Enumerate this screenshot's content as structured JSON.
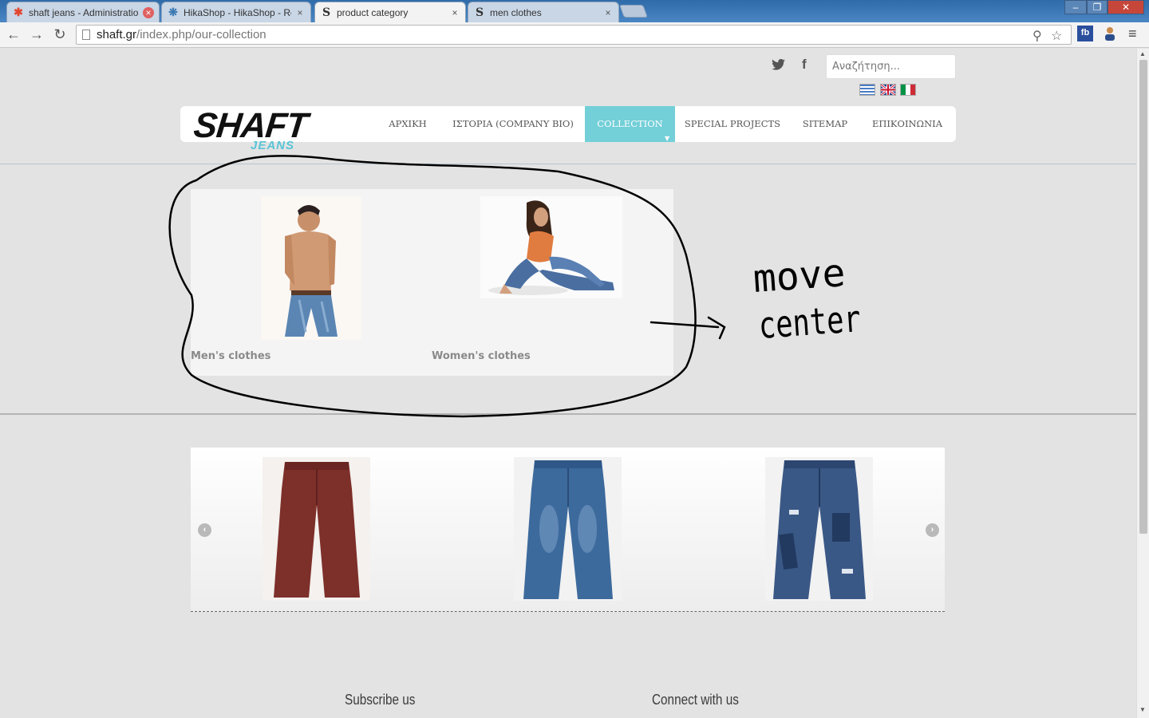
{
  "browser": {
    "tabs": [
      {
        "label": "shaft jeans - Administratio",
        "icon": "joomla-icon"
      },
      {
        "label": "HikaShop - HikaShop - Re",
        "icon": "hikashop-icon"
      },
      {
        "label": "product category",
        "icon": "shaft-s-icon"
      },
      {
        "label": "men clothes",
        "icon": "shaft-s-icon"
      }
    ],
    "url_host": "shaft.gr",
    "url_path": "/index.php/our-collection"
  },
  "header": {
    "search_placeholder": "Αναζήτηση...",
    "languages": [
      "Greek",
      "English",
      "Italian"
    ],
    "logo_main": "SHAFT",
    "logo_sub": "JEANS",
    "nav": [
      {
        "label": "ΑΡΧΙΚΗ"
      },
      {
        "label": "ΙΣΤΟΡΙΑ (COMPANY BIO)"
      },
      {
        "label": "COLLECTION"
      },
      {
        "label": "SPECIAL PROJECTS"
      },
      {
        "label": "SITEMAP"
      },
      {
        "label": "ΕΠΙΚΟΙΝΩΝΙΑ"
      }
    ]
  },
  "categories": [
    {
      "label": "Men's clothes"
    },
    {
      "label": "Women's clothes"
    }
  ],
  "carousel": {
    "products": [
      {
        "name": "red-chino-pants",
        "color": "#7d2f2a"
      },
      {
        "name": "blue-washed-jeans",
        "color": "#3d6a9c"
      },
      {
        "name": "patched-jeans",
        "color": "#3a5886"
      }
    ]
  },
  "footer": {
    "subscribe_title": "Subscribe us",
    "connect_title": "Connect with us"
  },
  "annotation": {
    "line1": "move",
    "line2": "center"
  },
  "colors": {
    "accent": "#73cfd8",
    "logo_jeans": "#58c4d6",
    "page_bg": "#e3e3e3"
  }
}
